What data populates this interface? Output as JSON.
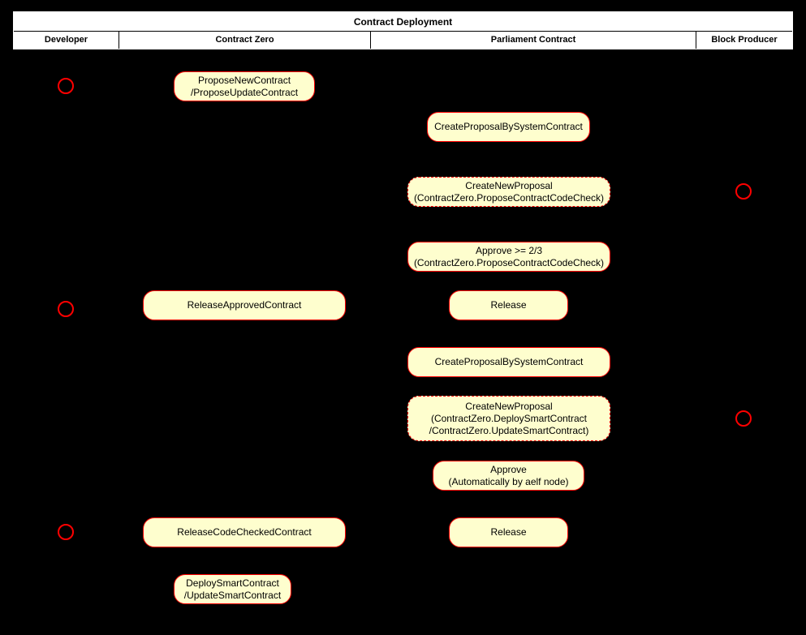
{
  "diagram": {
    "title": "Contract Deployment",
    "background_color": "#000000",
    "node_fill_color": "#FEFECE",
    "node_border_color": "#FF0000",
    "actor_color": "#FF0000",
    "header_background_color": "#FFFFFF"
  },
  "lanes": [
    {
      "label": "Developer"
    },
    {
      "label": "Contract Zero"
    },
    {
      "label": "Parliament Contract"
    },
    {
      "label": "Block Producer"
    }
  ],
  "actors": [
    {
      "name": "developer-start-circle",
      "lane": "Developer"
    },
    {
      "name": "block-producer-circle-1",
      "lane": "Block Producer"
    },
    {
      "name": "developer-circle-2",
      "lane": "Developer"
    },
    {
      "name": "block-producer-circle-2",
      "lane": "Block Producer"
    },
    {
      "name": "developer-circle-3",
      "lane": "Developer"
    }
  ],
  "nodes": [
    {
      "id": "propose-new-contract",
      "lane": "Contract Zero",
      "style": "solid",
      "lines": [
        "ProposeNewContract",
        "/ProposeUpdateContract"
      ]
    },
    {
      "id": "create-proposal-by-system-contract-1",
      "lane": "Parliament Contract",
      "style": "solid",
      "lines": [
        "CreateProposalBySystemContract"
      ]
    },
    {
      "id": "create-new-proposal-code-check",
      "lane": "Parliament Contract",
      "style": "dashed",
      "lines": [
        "CreateNewProposal",
        "(ContractZero.ProposeContractCodeCheck)"
      ]
    },
    {
      "id": "approve-two-thirds",
      "lane": "Parliament Contract",
      "style": "solid",
      "lines": [
        "Approve >= 2/3",
        "(ContractZero.ProposeContractCodeCheck)"
      ]
    },
    {
      "id": "release-approved-contract",
      "lane": "Contract Zero",
      "style": "solid",
      "lines": [
        "ReleaseApprovedContract"
      ]
    },
    {
      "id": "release-1",
      "lane": "Parliament Contract",
      "style": "solid",
      "lines": [
        "Release"
      ]
    },
    {
      "id": "create-proposal-by-system-contract-2",
      "lane": "Parliament Contract",
      "style": "solid",
      "lines": [
        "CreateProposalBySystemContract"
      ]
    },
    {
      "id": "create-new-proposal-deploy",
      "lane": "Parliament Contract",
      "style": "dashed",
      "lines": [
        "CreateNewProposal",
        "(ContractZero.DeploySmartContract",
        "/ContractZero.UpdateSmartContract)"
      ]
    },
    {
      "id": "approve-automatic",
      "lane": "Parliament Contract",
      "style": "solid",
      "lines": [
        "Approve",
        "(Automatically by aelf node)"
      ]
    },
    {
      "id": "release-code-checked-contract",
      "lane": "Contract Zero",
      "style": "solid",
      "lines": [
        "ReleaseCodeCheckedContract"
      ]
    },
    {
      "id": "release-2",
      "lane": "Parliament Contract",
      "style": "solid",
      "lines": [
        "Release"
      ]
    },
    {
      "id": "deploy-smart-contract",
      "lane": "Contract Zero",
      "style": "solid",
      "lines": [
        "DeploySmartContract",
        "/UpdateSmartContract"
      ]
    }
  ]
}
